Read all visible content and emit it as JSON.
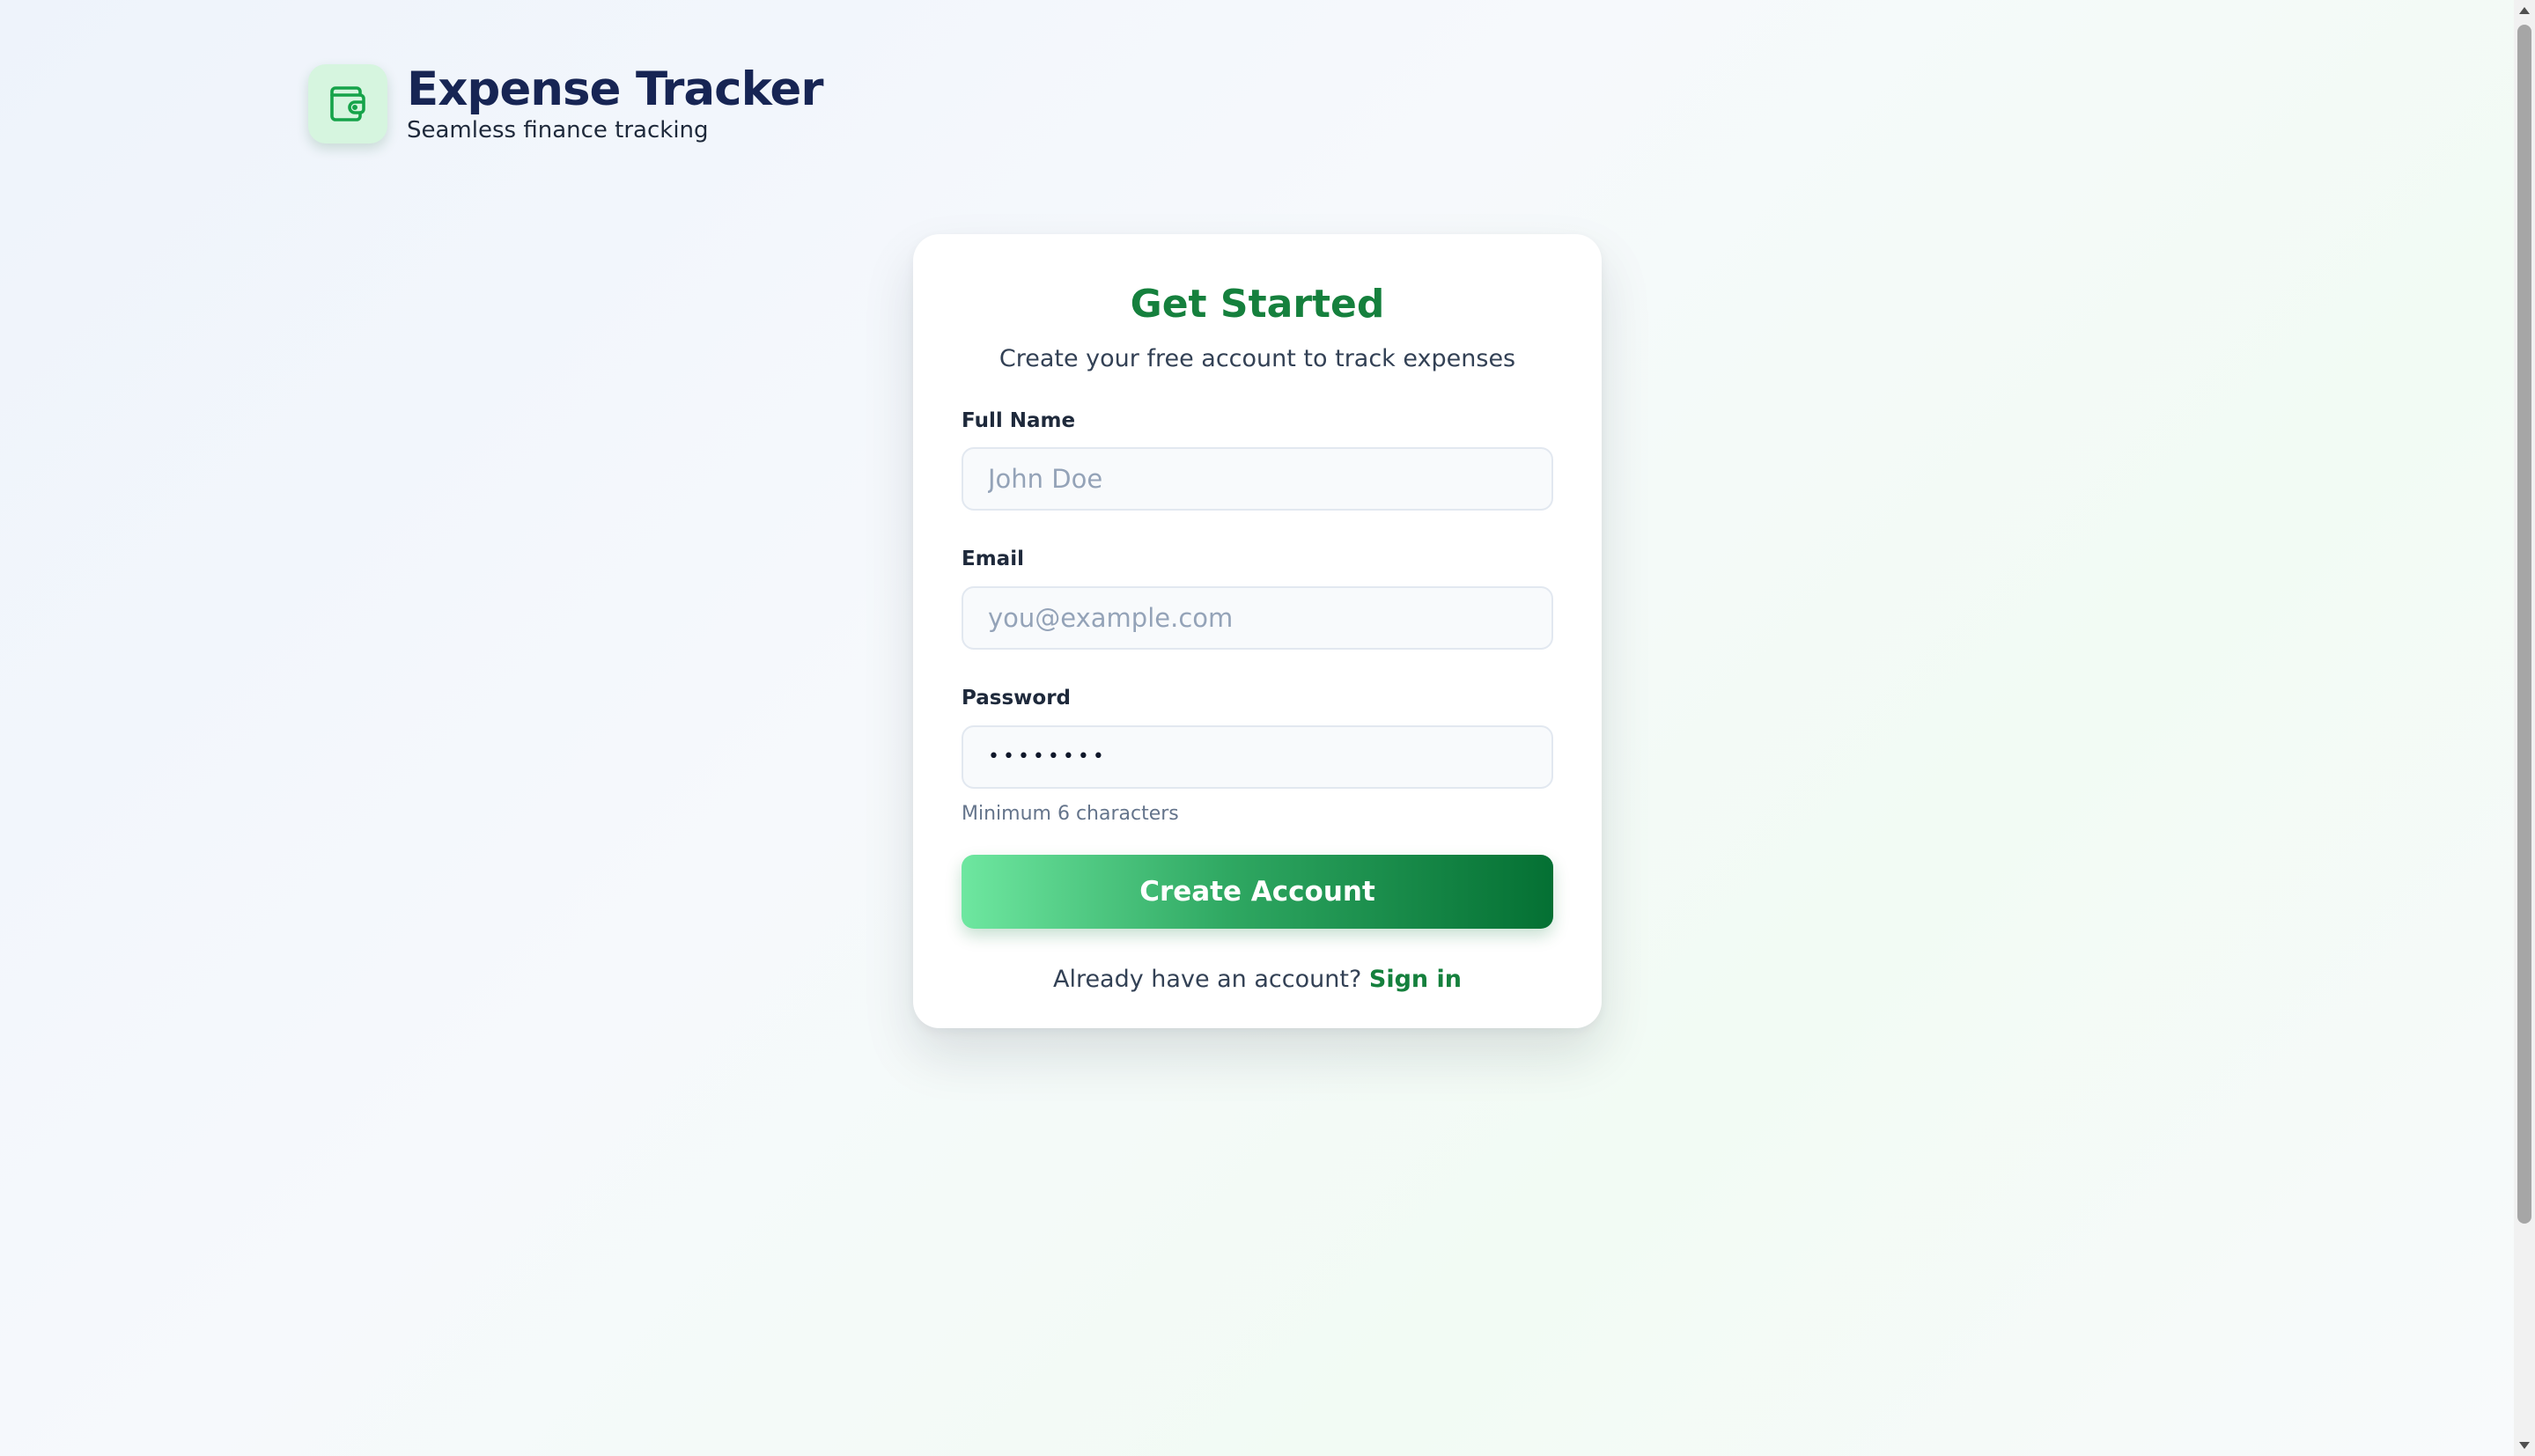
{
  "brand": {
    "title": "Expense Tracker",
    "subtitle": "Seamless finance tracking",
    "icon": "wallet-icon"
  },
  "card": {
    "title": "Get Started",
    "subtitle": "Create your free account to track expenses",
    "fields": {
      "full_name": {
        "label": "Full Name",
        "placeholder": "John Doe",
        "value": ""
      },
      "email": {
        "label": "Email",
        "placeholder": "you@example.com",
        "value": ""
      },
      "password": {
        "label": "Password",
        "placeholder": "",
        "value": "••••••••",
        "hint": "Minimum 6 characters"
      }
    },
    "submit_label": "Create Account",
    "signin_prompt": "Already have an account?",
    "signin_link": "Sign in"
  },
  "colors": {
    "accent": "#15803d",
    "brand_text": "#172554",
    "button_gradient_start": "#6ee7a0",
    "button_gradient_end": "#047033"
  }
}
